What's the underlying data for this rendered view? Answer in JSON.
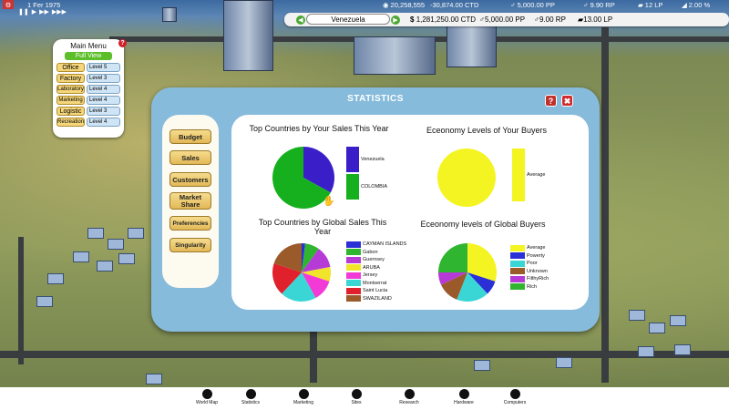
{
  "topbar": {
    "date": "1 Fer 1975",
    "money": "20,258,555",
    "ctd": "-30,874.00 CTD",
    "pp": "5,000.00 PP",
    "rp": "9.90 RP",
    "lp": "12 LP",
    "pct": "2.00 %"
  },
  "hud": {
    "country": "Venezuela",
    "balance": "1,281,250.00 CTD",
    "pp": "5,000.00 PP",
    "rp": "9.00 RP",
    "lp": "13.00 LP"
  },
  "main_menu": {
    "title": "Main Menu",
    "full_view": "Full View",
    "items": [
      {
        "label": "Office",
        "level": "Level 5"
      },
      {
        "label": "Factory",
        "level": "Level 3"
      },
      {
        "label": "Laboratory",
        "level": "Level 4"
      },
      {
        "label": "Marketing",
        "level": "Level 4"
      },
      {
        "label": "Logistic",
        "level": "Level 3"
      },
      {
        "label": "Recreation",
        "level": "Level 4"
      }
    ]
  },
  "statistics": {
    "title": "STATISTICS",
    "help": "?",
    "close": "✖",
    "tabs": [
      "Budget",
      "Sales",
      "Customers",
      "Market Share",
      "Preferencies",
      "Singularity"
    ]
  },
  "chart_data": [
    {
      "type": "pie",
      "title": "Top Countries by Your Sales This Year",
      "series": [
        {
          "name": "Venezuela",
          "value": 33,
          "color": "#3a1fc9"
        },
        {
          "name": "COLOMBIA",
          "value": 67,
          "color": "#16b01e"
        }
      ]
    },
    {
      "type": "pie",
      "title": "Eceonomy Levels of Your Buyers",
      "series": [
        {
          "name": "Average",
          "value": 100,
          "color": "#f4f422"
        }
      ]
    },
    {
      "type": "pie",
      "title": "Top Countries by Global Sales This Year",
      "series": [
        {
          "name": "CAYMAN ISLANDS",
          "value": 2,
          "color": "#2a2fd6"
        },
        {
          "name": "Gabon",
          "value": 8,
          "color": "#2fb52f"
        },
        {
          "name": "Guernsey",
          "value": 12,
          "color": "#b53ad6"
        },
        {
          "name": "ARUBA",
          "value": 8,
          "color": "#f0e52a"
        },
        {
          "name": "Jersey",
          "value": 12,
          "color": "#f23ad6"
        },
        {
          "name": "Montserrat",
          "value": 20,
          "color": "#3ad6d6"
        },
        {
          "name": "Saint Lucia",
          "value": 18,
          "color": "#e0202a"
        },
        {
          "name": "SWAZILAND",
          "value": 20,
          "color": "#9a5a2a"
        }
      ]
    },
    {
      "type": "pie",
      "title": "Eceonomy levels of Global Buyers",
      "series": [
        {
          "name": "Average",
          "value": 30,
          "color": "#f4f422"
        },
        {
          "name": "Powerty",
          "value": 8,
          "color": "#2a2fd6"
        },
        {
          "name": "Poor",
          "value": 18,
          "color": "#3ad6d6"
        },
        {
          "name": "Unknown",
          "value": 12,
          "color": "#9a5a2a"
        },
        {
          "name": "FilthyRich",
          "value": 7,
          "color": "#b53ad6"
        },
        {
          "name": "Rich",
          "value": 25,
          "color": "#2fb52f"
        }
      ]
    }
  ],
  "bottom": [
    "World Map",
    "Statistics",
    "Marketing",
    "Sites",
    "Research",
    "Hardware",
    "Computers"
  ]
}
